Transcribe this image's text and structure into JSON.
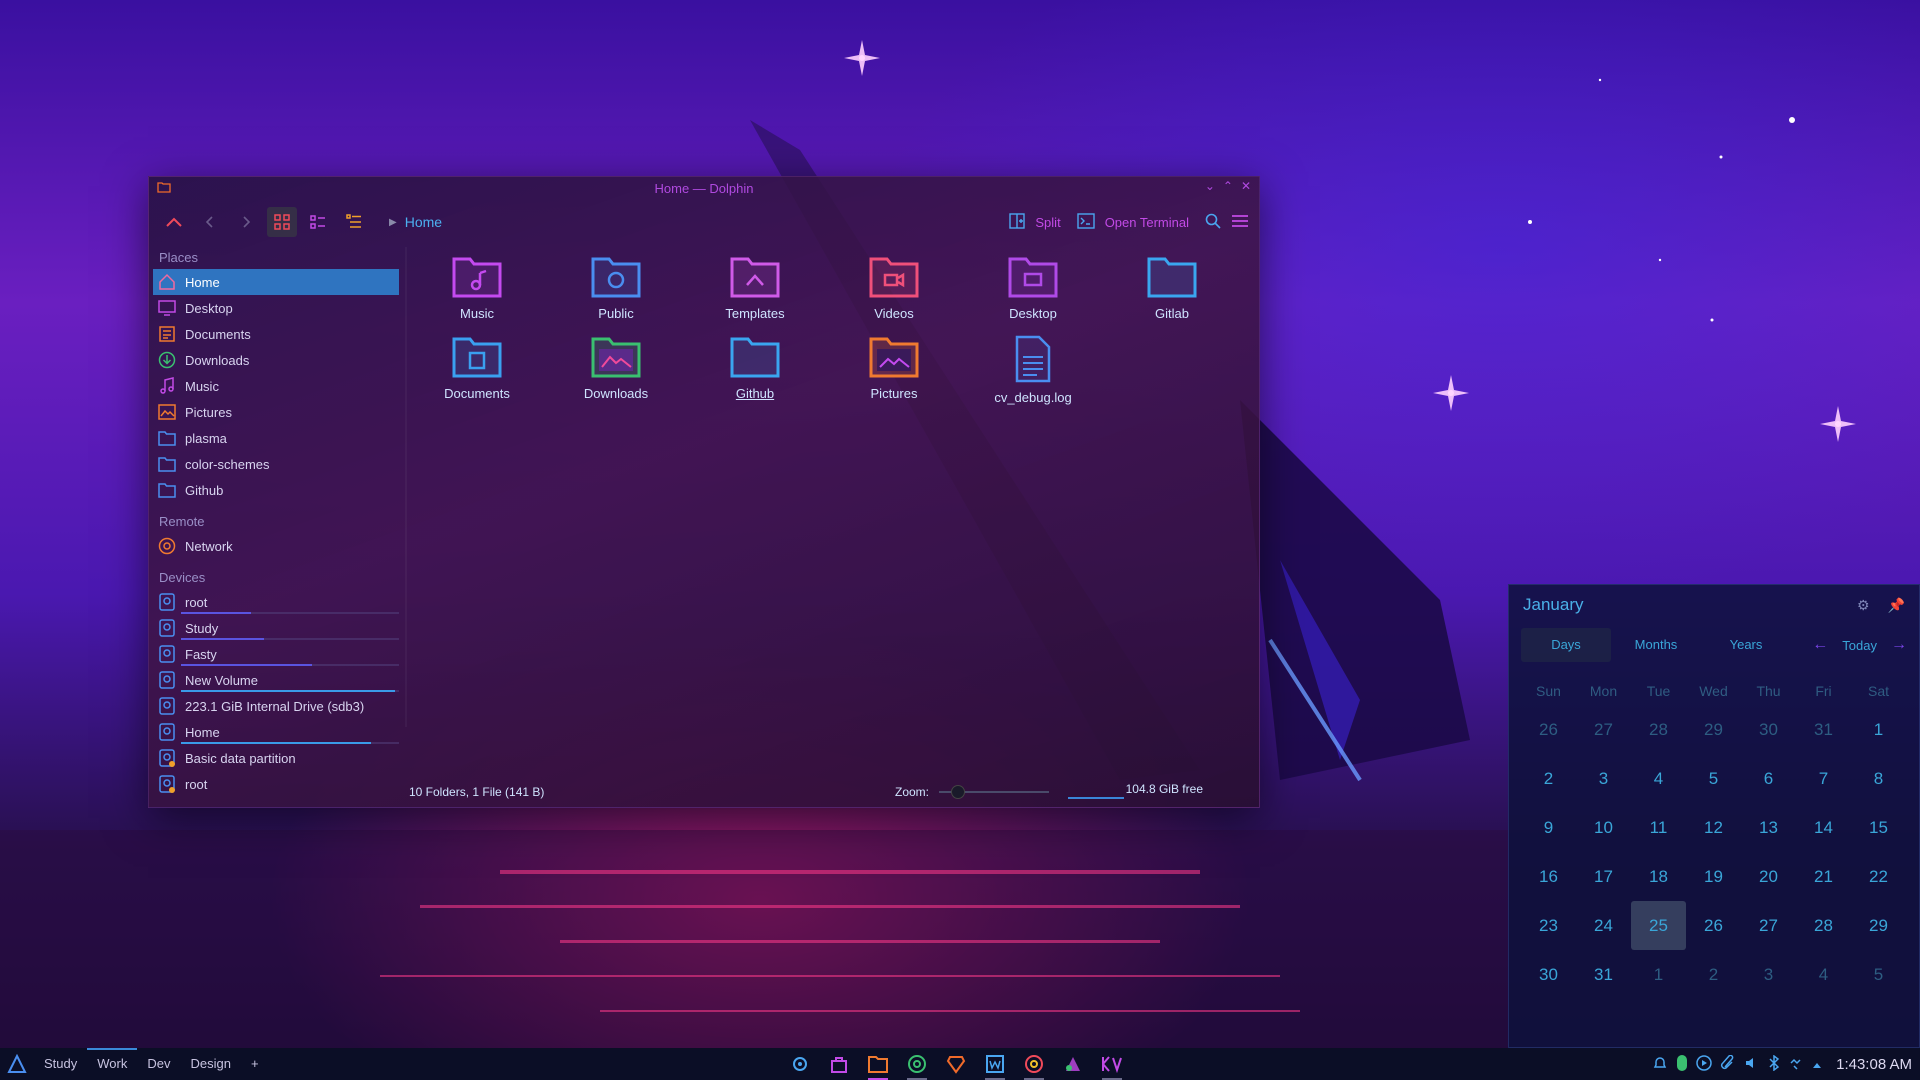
{
  "window": {
    "title": "Home — Dolphin",
    "breadcrumb": "Home",
    "toolbar": {
      "split_label": "Split",
      "terminal_label": "Open Terminal"
    },
    "places_title": "Places",
    "places": [
      {
        "label": "Home",
        "icon": "home-icon",
        "selected": true
      },
      {
        "label": "Desktop",
        "icon": "desktop-icon"
      },
      {
        "label": "Documents",
        "icon": "documents-icon"
      },
      {
        "label": "Downloads",
        "icon": "downloads-icon"
      },
      {
        "label": "Music",
        "icon": "music-icon"
      },
      {
        "label": "Pictures",
        "icon": "pictures-icon"
      },
      {
        "label": "plasma",
        "icon": "folder-icon"
      },
      {
        "label": "color-schemes",
        "icon": "folder-icon"
      },
      {
        "label": "Github",
        "icon": "folder-icon"
      }
    ],
    "remote_title": "Remote",
    "remote": [
      {
        "label": "Network",
        "icon": "network-icon"
      }
    ],
    "devices_title": "Devices",
    "devices": [
      {
        "label": "root",
        "usage": 0.32
      },
      {
        "label": "Study",
        "usage": 0.38
      },
      {
        "label": "Fasty",
        "usage": 0.6
      },
      {
        "label": "New Volume",
        "usage": 0.98
      },
      {
        "label": "223.1 GiB Internal Drive (sdb3)",
        "usage": null
      },
      {
        "label": "Home",
        "usage": 0.87
      },
      {
        "label": "Basic data partition",
        "usage": null
      },
      {
        "label": "root",
        "usage": null
      }
    ],
    "files": [
      {
        "label": "Music",
        "icon": "music-folder-icon",
        "color": "#c44af0"
      },
      {
        "label": "Public",
        "icon": "public-folder-icon",
        "color": "#4a8ef0"
      },
      {
        "label": "Templates",
        "icon": "templates-folder-icon",
        "color": "#d05ae8"
      },
      {
        "label": "Videos",
        "icon": "videos-folder-icon",
        "color": "#f0507a"
      },
      {
        "label": "Desktop",
        "icon": "desktop-folder-icon",
        "color": "#b04ae8"
      },
      {
        "label": "Gitlab",
        "icon": "folder-icon",
        "color": "#3aa6f0"
      },
      {
        "label": "Documents",
        "icon": "documents-folder-icon",
        "color": "#3aa0f0"
      },
      {
        "label": "Downloads",
        "icon": "downloads-folder-icon",
        "color": "#3ac070"
      },
      {
        "label": "Github",
        "icon": "folder-icon",
        "color": "#3aa6f0"
      },
      {
        "label": "Pictures",
        "icon": "pictures-folder-icon",
        "color": "#f07a30"
      },
      {
        "label": "cv_debug.log",
        "icon": "text-file-icon",
        "color": "#4a8ef0"
      }
    ],
    "status": {
      "summary": "10 Folders, 1 File (141 B)",
      "zoom_label": "Zoom:",
      "free": "104.8 GiB free"
    }
  },
  "calendar": {
    "month": "January",
    "tabs": [
      "Days",
      "Months",
      "Years"
    ],
    "active_tab": "Days",
    "today_label": "Today",
    "weekdays": [
      "Sun",
      "Mon",
      "Tue",
      "Wed",
      "Thu",
      "Fri",
      "Sat"
    ],
    "weeks": [
      [
        "26",
        "27",
        "28",
        "29",
        "30",
        "31",
        "1"
      ],
      [
        "2",
        "3",
        "4",
        "5",
        "6",
        "7",
        "8"
      ],
      [
        "9",
        "10",
        "11",
        "12",
        "13",
        "14",
        "15"
      ],
      [
        "16",
        "17",
        "18",
        "19",
        "20",
        "21",
        "22"
      ],
      [
        "23",
        "24",
        "25",
        "26",
        "27",
        "28",
        "29"
      ],
      [
        "30",
        "31",
        "1",
        "2",
        "3",
        "4",
        "5"
      ]
    ],
    "today": "25"
  },
  "taskbar": {
    "desktops": [
      "Study",
      "Work",
      "Dev",
      "Design"
    ],
    "active_desktop": "Work",
    "add_label": "+",
    "tasks": [
      "settings-icon",
      "store-icon",
      "file-manager-icon",
      "chrome-icon",
      "brave-icon",
      "writer-icon",
      "chrome-icon",
      "krita-icon",
      "kvantum-icon"
    ],
    "clock": "1:43:08 AM"
  },
  "colors": {
    "accent": "#c24ae6",
    "selection": "#2f74c0",
    "calendar_text": "#3aa6d8"
  }
}
